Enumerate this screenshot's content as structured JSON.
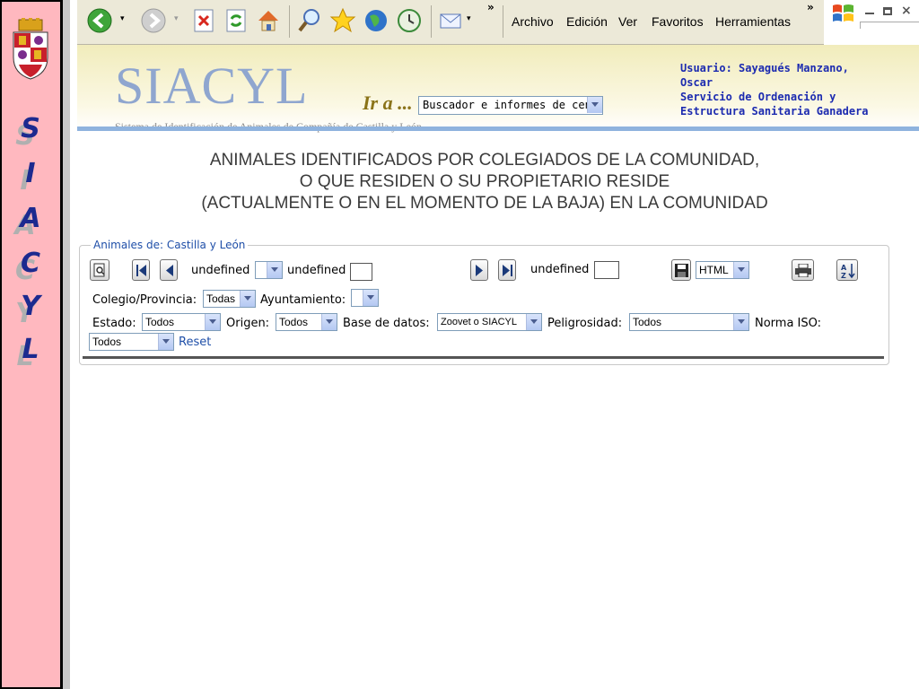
{
  "sidebar": {
    "letters": [
      "S",
      "I",
      "A",
      "C",
      "Y",
      "L"
    ]
  },
  "browser": {
    "menu": [
      "Archivo",
      "Edición",
      "Ver",
      "Favoritos",
      "Herramientas"
    ],
    "chevron": "»",
    "icons": [
      "back-icon",
      "forward-icon",
      "stop-icon",
      "refresh-icon",
      "home-icon",
      "search-icon",
      "favorites-star-icon",
      "media-icon",
      "history-icon",
      "mail-icon"
    ]
  },
  "header": {
    "brand": "SIACYL",
    "brand_subtitle": "Sistema de Identificación de Animales de Compañía de Castilla y León",
    "goto_label": "Ir a ...",
    "goto_value": "Buscador e informes de censo",
    "user_line1": "Usuario: Sayagués Manzano,",
    "user_line2": "Oscar",
    "service_line1": "Servicio de Ordenación y",
    "service_line2": "Estructura Sanitaria Ganadera"
  },
  "title": {
    "line1": "ANIMALES IDENTIFICADOS POR COLEGIADOS DE LA COMUNIDAD,",
    "line2": "O QUE RESIDEN O SU PROPIETARIO RESIDE",
    "line3": "(ACTUALMENTE O EN EL MOMENTO DE LA BAJA) EN LA COMUNIDAD"
  },
  "panel": {
    "legend": "Animales de: Castilla y León",
    "pager_label1": "undefined",
    "pager_label2": "undefined",
    "pager_label3": "undefined",
    "export_format": "HTML",
    "colegio_label": "Colegio/Provincia:",
    "colegio_value": "Todas",
    "ayuntamiento_label": "Ayuntamiento:",
    "ayuntamiento_value": "",
    "estado_label": "Estado:",
    "estado_value": "Todos",
    "origen_label": "Origen:",
    "origen_value": "Todos",
    "basedatos_label": "Base de datos:",
    "basedatos_value": "Zoovet o SIACYL",
    "peligrosidad_label": "Peligrosidad:",
    "peligrosidad_value": "Todos",
    "norma_label": "Norma ISO:",
    "norma_value": "Todos",
    "reset_label": "Reset"
  }
}
